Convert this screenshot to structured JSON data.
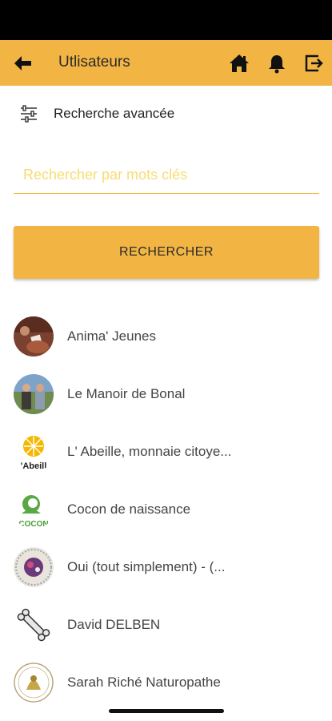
{
  "app_bar": {
    "title": "Utlisateurs",
    "back_icon": "arrow-left-icon",
    "actions": [
      "home-icon",
      "bell-icon",
      "logout-icon"
    ],
    "color": "#f2b544"
  },
  "advanced_search": {
    "label": "Recherche avancée",
    "icon": "sliders-icon"
  },
  "search": {
    "placeholder": "Rechercher par mots clés",
    "value": ""
  },
  "search_button": {
    "label": "RECHERCHER"
  },
  "users": [
    {
      "name": "Anima' Jeunes"
    },
    {
      "name": "Le Manoir de Bonal"
    },
    {
      "name": "L' Abeille, monnaie citoye..."
    },
    {
      "name": "Cocon de naissance"
    },
    {
      "name": "Oui (tout simplement) - (..."
    },
    {
      "name": "David DELBEN"
    },
    {
      "name": "Sarah Riché Naturopathe"
    }
  ],
  "avatar_texts": {
    "abeille": "'Abeill",
    "cocon": "COCON"
  }
}
